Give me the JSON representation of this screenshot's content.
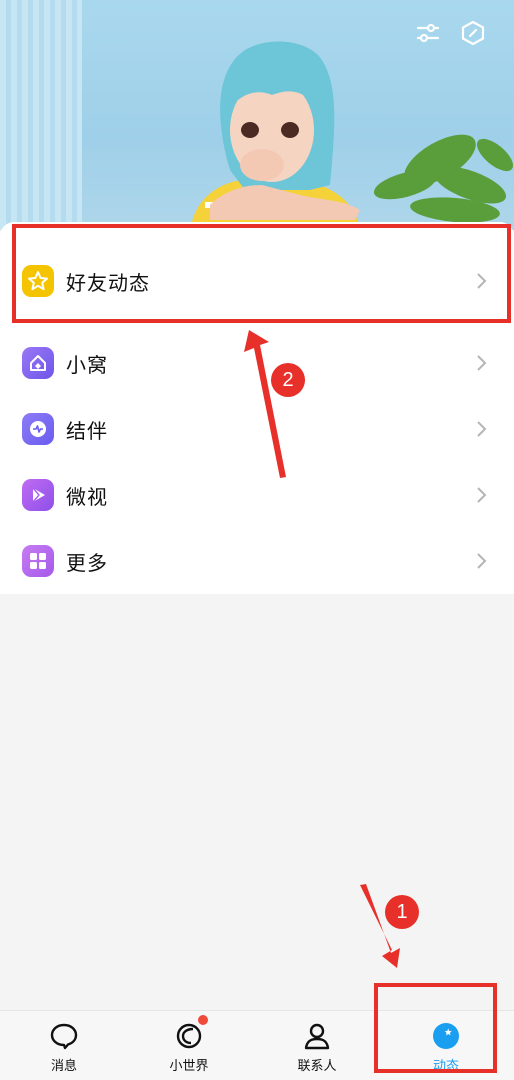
{
  "menu": {
    "items": [
      {
        "label": "好友动态",
        "icon": "star-icon",
        "color": "#f5c400"
      },
      {
        "label": "小窝",
        "icon": "home-icon",
        "color": "#7b61f0"
      },
      {
        "label": "结伴",
        "icon": "chat-pulse-icon",
        "color": "#7a6cf2"
      },
      {
        "label": "微视",
        "icon": "play-icon",
        "color": "#a85ef0"
      },
      {
        "label": "更多",
        "icon": "grid-icon",
        "color": "#b464ee"
      }
    ]
  },
  "tabs": [
    {
      "label": "消息",
      "icon": "chat-bubble-icon"
    },
    {
      "label": "小世界",
      "icon": "planet-icon",
      "badge": true
    },
    {
      "label": "联系人",
      "icon": "person-icon"
    },
    {
      "label": "动态",
      "icon": "star-circle-icon",
      "active": true
    }
  ],
  "annotations": {
    "step1": "1",
    "step2": "2",
    "color": "#e8302a"
  },
  "colors": {
    "active_tab": "#1a9ef0",
    "banner": "#a9d8ee"
  }
}
